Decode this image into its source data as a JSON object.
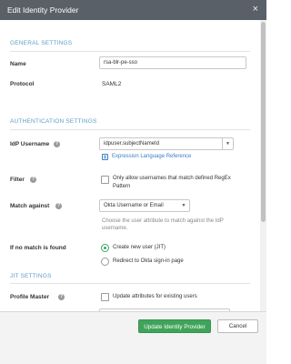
{
  "dialog": {
    "title": "Edit Identity Provider",
    "close_glyph": "×"
  },
  "general": {
    "section_title": "GENERAL SETTINGS",
    "name_label": "Name",
    "name_value": "rsa-blr-pe-sso",
    "protocol_label": "Protocol",
    "protocol_value": "SAML2"
  },
  "auth": {
    "section_title": "AUTHENTICATION SETTINGS",
    "idp_username_label": "IdP Username",
    "idp_username_value": "idpuser.subjectNameId",
    "expression_link": "Expression Language Reference",
    "filter_label": "Filter",
    "filter_text_line1": "Only allow usernames that match defined RegEx",
    "filter_text_line2": "Pattern",
    "filter_checked": false,
    "match_against_label": "Match against",
    "match_against_value": "Okta Username or Email",
    "match_hint_line1": "Choose the user attribute to match against the IdP",
    "match_hint_line2": "username.",
    "no_match_label": "If no match is found",
    "radio_options": [
      {
        "label": "Create new user (JIT)",
        "selected": true
      },
      {
        "label": "Redirect to Okta sign-in page",
        "selected": false
      }
    ]
  },
  "jit": {
    "section_title": "JIT SETTINGS",
    "profile_master_label": "Profile Master",
    "profile_master_text": "Update attributes for existing users",
    "profile_master_checked": false
  },
  "footer": {
    "update_button": "Update Identity Provider",
    "cancel_button": "Cancel"
  },
  "icons": {
    "help": "question-circle-icon",
    "caret": "chevron-down-icon",
    "link": "external-reference-icon"
  },
  "colors": {
    "header_bg": "#5a6067",
    "section_title": "#5c9ec7",
    "link": "#3b7fc4",
    "primary_button": "#3fa45a",
    "radio_selected": "#3aa767"
  }
}
